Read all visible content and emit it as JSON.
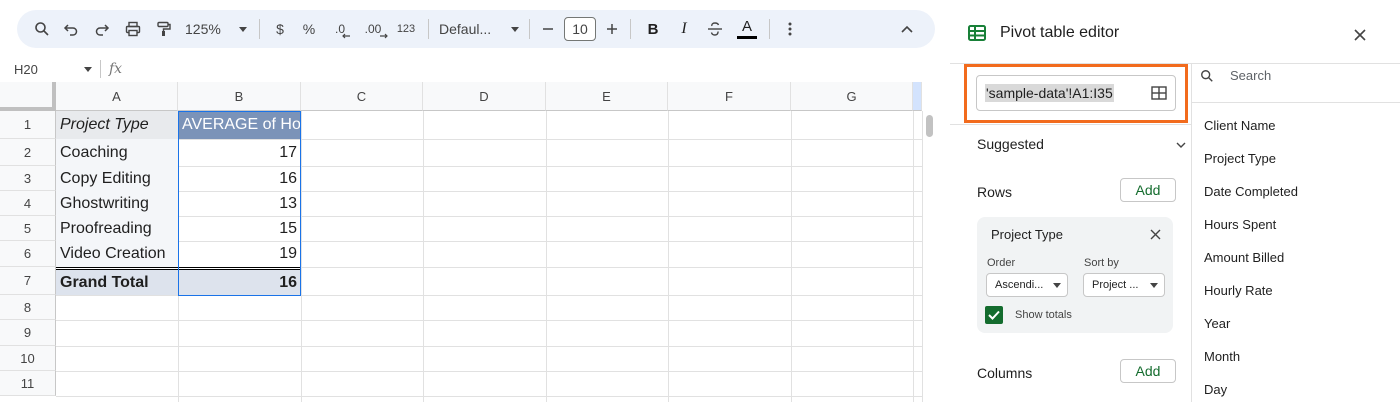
{
  "toolbar": {
    "zoom": "125%",
    "currency": "$",
    "percent": "%",
    "dec_decrease": ".0",
    "dec_increase": ".00",
    "number_format": "123",
    "font": "Defaul...",
    "font_size": "10",
    "bold": "B",
    "italic": "I",
    "text_color_letter": "A"
  },
  "formula_bar": {
    "cell_ref": "H20",
    "fx": "fx"
  },
  "sheet": {
    "columns": [
      "A",
      "B",
      "C",
      "D",
      "E",
      "F",
      "G"
    ],
    "rows": [
      "1",
      "2",
      "3",
      "4",
      "5",
      "6",
      "7",
      "8",
      "9",
      "10",
      "11"
    ],
    "header": {
      "a": "Project Type",
      "b": "AVERAGE of Ho"
    },
    "data": [
      {
        "type": "Coaching",
        "avg": "17"
      },
      {
        "type": "Copy Editing",
        "avg": "16"
      },
      {
        "type": "Ghostwriting",
        "avg": "13"
      },
      {
        "type": "Proofreading",
        "avg": "15"
      },
      {
        "type": "Video Creation",
        "avg": "19"
      }
    ],
    "total": {
      "label": "Grand Total",
      "value": "16"
    }
  },
  "panel": {
    "title": "Pivot table editor",
    "range": "'sample-data'!A1:I35",
    "suggested": "Suggested",
    "rows_label": "Rows",
    "add_label": "Add",
    "columns_label": "Columns",
    "card": {
      "title": "Project Type",
      "order_label": "Order",
      "order_value": "Ascendi...",
      "sort_label": "Sort by",
      "sort_value": "Project ...",
      "show_totals": "Show totals"
    },
    "search_placeholder": "Search",
    "fields": [
      "Client Name",
      "Project Type",
      "Date Completed",
      "Hours Spent",
      "Amount Billed",
      "Hourly Rate",
      "Year",
      "Month",
      "Day"
    ]
  },
  "colors": {
    "accent_orange": "#f26b1d",
    "header_blue": "#7b93b8",
    "green": "#146c2e"
  }
}
